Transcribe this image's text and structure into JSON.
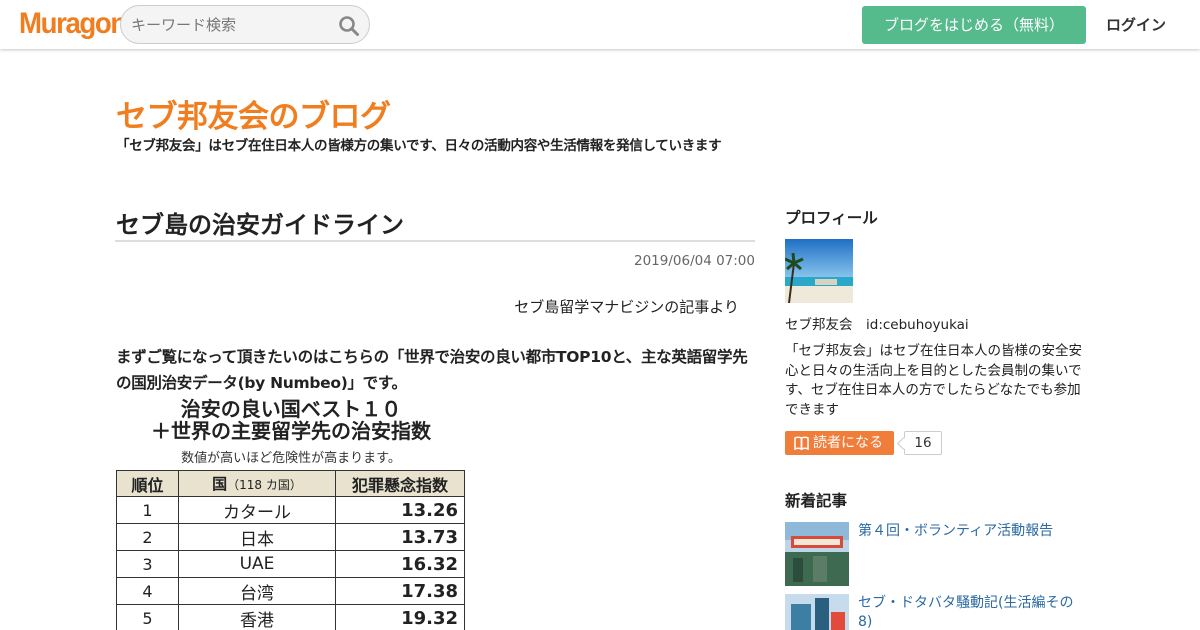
{
  "header": {
    "logo_text": "Muragon",
    "search_placeholder": "キーワード検索",
    "start_blog_label": "ブログをはじめる（無料）",
    "login_label": "ログイン",
    "brand_color": "#f07d1e",
    "cta_color": "#55bb8c"
  },
  "blog": {
    "title": "セブ邦友会のブログ",
    "description": "「セブ邦友会」はセブ在住日本人の皆様方の集いです、日々の活動内容や生活情報を発信していきます"
  },
  "article": {
    "title": "セブ島の治安ガイドライン",
    "date": "2019/06/04 07:00",
    "source": "セブ島留学マナビジンの記事より",
    "lead": "まずご覧になって頂きたいのはこちらの「世界で治安の良い都市TOP10と、主な英語留学先の国別治安データ(by Numbeo)」です。",
    "figure": {
      "heading_line1": "治安の良い国ベスト１０",
      "heading_line2": "＋世界の主要留学先の治安指数",
      "note": "数値が高いほど危険性が高まります。",
      "headers": {
        "rank": "順位",
        "country": "国",
        "country_count": "（118 カ国）",
        "index": "犯罪懸念指数"
      },
      "rows": [
        {
          "rank": "1",
          "country": "カタール",
          "index": "13.26"
        },
        {
          "rank": "2",
          "country": "日本",
          "index": "13.73"
        },
        {
          "rank": "3",
          "country": "UAE",
          "index": "16.32"
        },
        {
          "rank": "4",
          "country": "台湾",
          "index": "17.38"
        },
        {
          "rank": "5",
          "country": "香港",
          "index": "19.32"
        }
      ]
    }
  },
  "sidebar": {
    "profile_heading": "プロフィール",
    "profile_name": "セブ邦友会　id:cebuhoyukai",
    "profile_desc": "「セブ邦友会」はセブ在住日本人の皆様の安全安心と日々の生活向上を目的とした会員制の集いです、セブ在住日本人の方でしたらどなたでも参加できます",
    "follow_label": "読者になる",
    "follow_count": "16",
    "recent_heading": "新着記事",
    "recent": [
      {
        "title": "第４回・ボランティア活動報告"
      },
      {
        "title": "セブ・ドタバタ騒動記(生活編その8)"
      }
    ]
  }
}
